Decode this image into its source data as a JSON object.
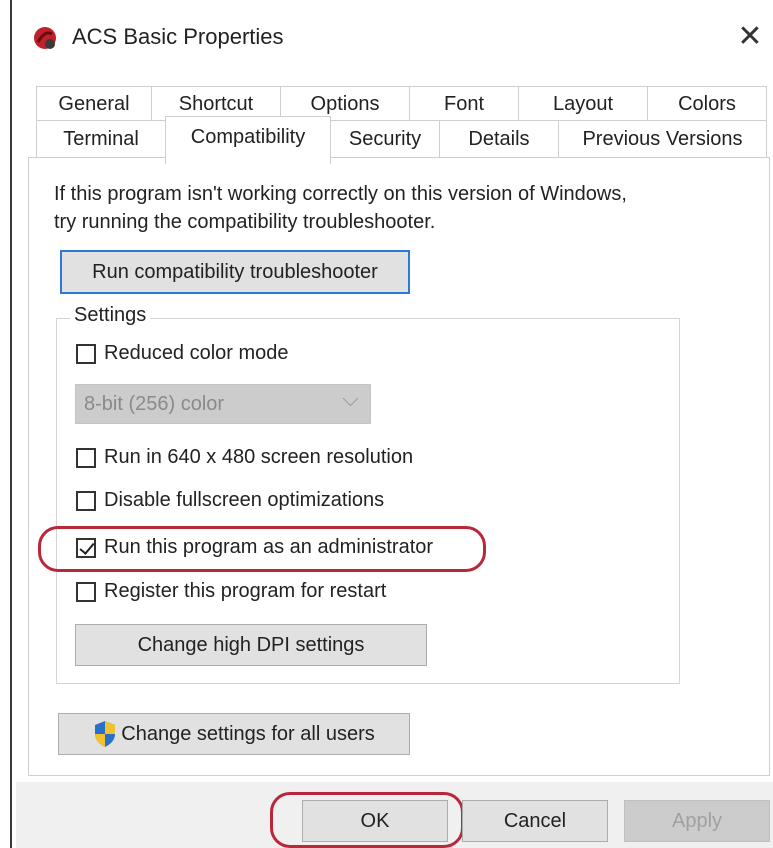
{
  "window": {
    "title": "ACS Basic Properties",
    "close_glyph": "✕"
  },
  "tabs_row1": [
    {
      "label": "General"
    },
    {
      "label": "Shortcut"
    },
    {
      "label": "Options"
    },
    {
      "label": "Font"
    },
    {
      "label": "Layout"
    },
    {
      "label": "Colors"
    }
  ],
  "tabs_row2": [
    {
      "label": "Terminal"
    },
    {
      "label": "Compatibility",
      "active": true
    },
    {
      "label": "Security"
    },
    {
      "label": "Details"
    },
    {
      "label": "Previous Versions"
    }
  ],
  "compat": {
    "description_line1": "If this program isn't working correctly on this version of Windows,",
    "description_line2": "try running the compatibility troubleshooter.",
    "troubleshooter_button": "Run compatibility troubleshooter"
  },
  "settings": {
    "group_label": "Settings",
    "reduced_color": {
      "label": "Reduced color mode",
      "checked": false
    },
    "color_select": {
      "value": "8-bit (256) color"
    },
    "resolution_640": {
      "label": "Run in 640 x 480 screen resolution",
      "checked": false
    },
    "disable_fullscreen": {
      "label": "Disable fullscreen optimizations",
      "checked": false
    },
    "run_as_admin": {
      "label": "Run this program as an administrator",
      "checked": true
    },
    "register_restart": {
      "label": "Register this program for restart",
      "checked": false
    },
    "dpi_button": "Change high DPI settings"
  },
  "change_all_users_button": "Change settings for all users",
  "footer": {
    "ok": "OK",
    "cancel": "Cancel",
    "apply": "Apply"
  },
  "colors": {
    "highlight": "#b8283a",
    "focus": "#2b7bd6"
  }
}
